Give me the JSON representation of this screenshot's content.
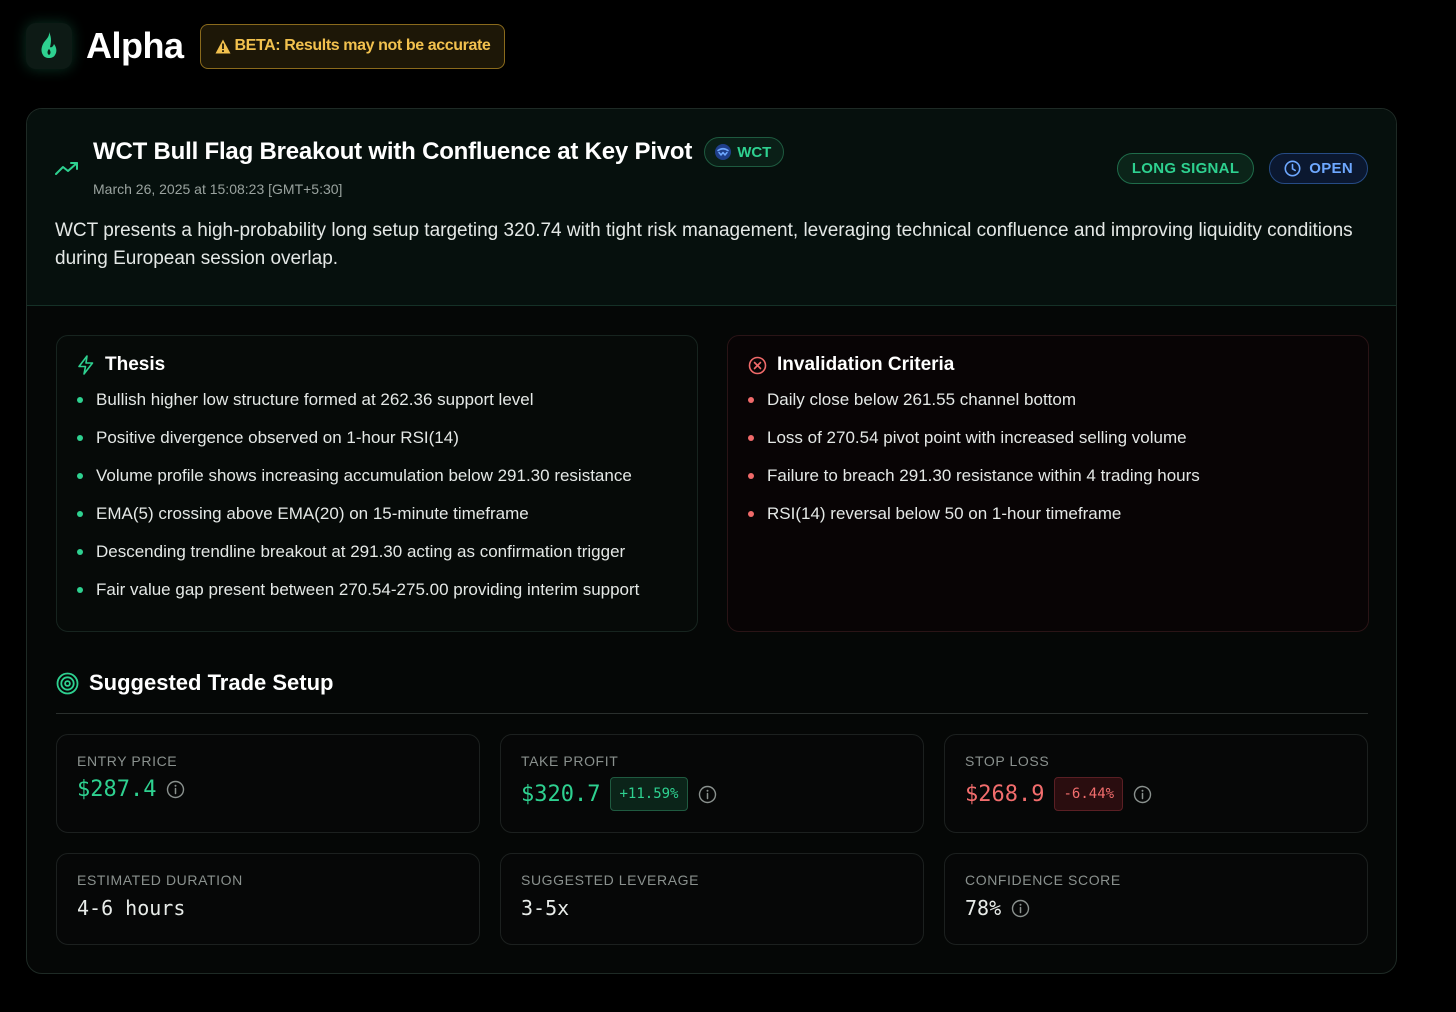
{
  "app": {
    "brand": "Alpha",
    "beta_warning": "BETA: Results may not be accurate"
  },
  "signal": {
    "title": "WCT Bull Flag Breakout with Confluence at Key Pivot",
    "token_chip": "WCT",
    "timestamp": "March 26, 2025 at 15:08:23 [GMT+5:30]",
    "direction_badge": "LONG SIGNAL",
    "status_badge": "OPEN",
    "summary": "WCT presents a high-probability long setup targeting 320.74 with tight risk management, leveraging technical confluence and improving liquidity conditions during European session overlap."
  },
  "thesis": {
    "heading": "Thesis",
    "items": [
      "Bullish higher low structure formed at 262.36 support level",
      "Positive divergence observed on 1-hour RSI(14)",
      "Volume profile shows increasing accumulation below 291.30 resistance",
      "EMA(5) crossing above EMA(20) on 15-minute timeframe",
      "Descending trendline breakout at 291.30 acting as confirmation trigger",
      "Fair value gap present between 270.54-275.00 providing interim support"
    ]
  },
  "invalidation": {
    "heading": "Invalidation Criteria",
    "items": [
      "Daily close below 261.55 channel bottom",
      "Loss of 270.54 pivot point with increased selling volume",
      "Failure to breach 291.30 resistance within 4 trading hours",
      "RSI(14) reversal below 50 on 1-hour timeframe"
    ]
  },
  "setup": {
    "heading": "Suggested Trade Setup",
    "entry": {
      "label": "ENTRY PRICE",
      "value": "$287.4"
    },
    "take_profit": {
      "label": "TAKE PROFIT",
      "value": "$320.7",
      "change": "+11.59%"
    },
    "stop_loss": {
      "label": "STOP LOSS",
      "value": "$268.9",
      "change": "-6.44%"
    },
    "duration": {
      "label": "ESTIMATED DURATION",
      "value": "4-6 hours"
    },
    "leverage": {
      "label": "SUGGESTED LEVERAGE",
      "value": "3-5x"
    },
    "confidence": {
      "label": "CONFIDENCE SCORE",
      "value": "78%"
    }
  },
  "colors": {
    "accent_green": "#2ed190",
    "accent_red": "#f26d6d",
    "accent_blue": "#6ea8ff",
    "warning_amber": "#f2c14e"
  },
  "icons": {
    "logo": "flame-icon",
    "beta": "warning-triangle-icon",
    "title": "trending-up-icon",
    "token": "wct-token-icon",
    "status": "clock-icon",
    "thesis": "lightning-bolt-icon",
    "invalidation": "x-circle-icon",
    "setup": "target-icon",
    "info": "info-icon"
  }
}
